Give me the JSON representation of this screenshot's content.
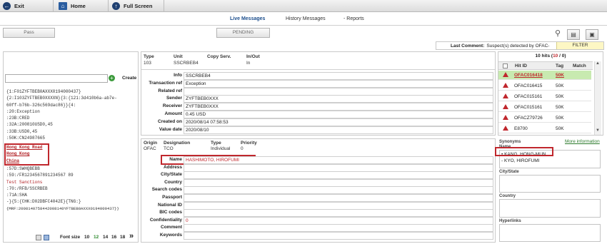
{
  "topbar": {
    "exit": "Exit",
    "home": "Home",
    "fullscreen": "Full Screen"
  },
  "tabs": {
    "live": "Live Messages",
    "history": "History Messages",
    "reports": "- Reports"
  },
  "actions": {
    "pass": "Pass",
    "pending": "PENDING"
  },
  "last_comment": {
    "label": "Last Comment:",
    "text": "Suspect(s) detected by OFAC-",
    "filter": "FILTER"
  },
  "search": {
    "value": "",
    "create": "Create"
  },
  "message_lines": [
    "{1:F01ZYFTBEB0AXXX0194000437}",
    "{2:I103ZYFTBEB0XXXXN}{3:{121:3d410b6a-ab7e-",
    "60ff-b76b-326c569dac86}}{4:",
    ":20:Exception",
    ":23B:CRED",
    ":32A:200810USD0,45",
    ":33B:USD0,45",
    ":50K:CN24987665"
  ],
  "highlighted_lines": [
    "Hong Kong Road",
    "Hong Kong",
    "China"
  ],
  "message_lines_after": [
    ":57D:SWHQBEBB",
    ":59:/FR1234567891234567 89",
    "Test Sanctions",
    ":70:/RFB/SSCRBEB",
    ":71A:SHA",
    "-}{5:{CHK:D02DBFC4042E}{TNG:}",
    "{MRF:2008140758442008140YFTBEB0AXXX0194000437}}"
  ],
  "font_size": {
    "label": "Font size",
    "options": [
      "10",
      "12",
      "14",
      "16",
      "18"
    ],
    "selected": "12"
  },
  "summary": {
    "type_label": "Type",
    "type": "103",
    "unit_label": "Unit",
    "unit": "SSCRBEB4",
    "copy_label": "Copy Serv.",
    "inout_label": "In/Out",
    "inout": "In"
  },
  "details": [
    {
      "label": "Info",
      "value": "SSCRBEB4"
    },
    {
      "label": "Transaction ref",
      "value": "Exception"
    },
    {
      "label": "Related ref",
      "value": ""
    },
    {
      "label": "Sender",
      "value": "ZYFTBEB0XXX"
    },
    {
      "label": "Receiver",
      "value": "ZYFTBEB0XXX"
    },
    {
      "label": "Amount",
      "value": "0.45 USD"
    },
    {
      "label": "Created on",
      "value": "2020/08/14 07:58:53"
    },
    {
      "label": "Value date",
      "value": "2020/08/10"
    }
  ],
  "origin": {
    "origin_label": "Origin",
    "origin": "OFAC",
    "designation_label": "Designation",
    "designation": "TCO",
    "type_label": "Type",
    "type": "Individual",
    "priority_label": "Priority",
    "priority": "0"
  },
  "entity": [
    {
      "label": "Name",
      "value": "HASHIMOTO, HIROFUMI"
    },
    {
      "label": "Address",
      "value": ""
    },
    {
      "label": "City/State",
      "value": ""
    },
    {
      "label": "Country",
      "value": ""
    },
    {
      "label": "Search codes",
      "value": ""
    },
    {
      "label": "Passport",
      "value": ""
    },
    {
      "label": "National ID",
      "value": ""
    },
    {
      "label": "BIC codes",
      "value": ""
    },
    {
      "label": "Confidentiality",
      "value": "0"
    },
    {
      "label": "Comment",
      "value": ""
    },
    {
      "label": "Keywords",
      "value": ""
    }
  ],
  "hits": {
    "title_prefix": "10 hits (",
    "count_red": "10",
    "title_suffix": " / 0)",
    "col_hit": "Hit ID",
    "col_tag": "Tag",
    "col_match": "Match",
    "rows": [
      {
        "id": "OFAC016418",
        "tag": "50K"
      },
      {
        "id": "OFAC016415",
        "tag": "50K"
      },
      {
        "id": "OFAC015161",
        "tag": "50K"
      },
      {
        "id": "OFAC015161",
        "tag": "50K"
      },
      {
        "id": "OFACZ79726",
        "tag": "50K"
      },
      {
        "id": "E8700",
        "tag": "50K"
      }
    ]
  },
  "synonyms": {
    "title": "Synonyms",
    "more": "More information",
    "caption": "Name",
    "items": [
      "KANG, HONG-MUN",
      "KYO, HIROFUMI"
    ],
    "city_label": "City/State",
    "country_label": "Country",
    "hyperlinks_label": "Hyperlinks"
  },
  "colors": {
    "accent": "#1d4f8d",
    "alert": "#c0272d",
    "selected_row": "#c8eab0",
    "filter_bg": "#fdf7c4"
  }
}
